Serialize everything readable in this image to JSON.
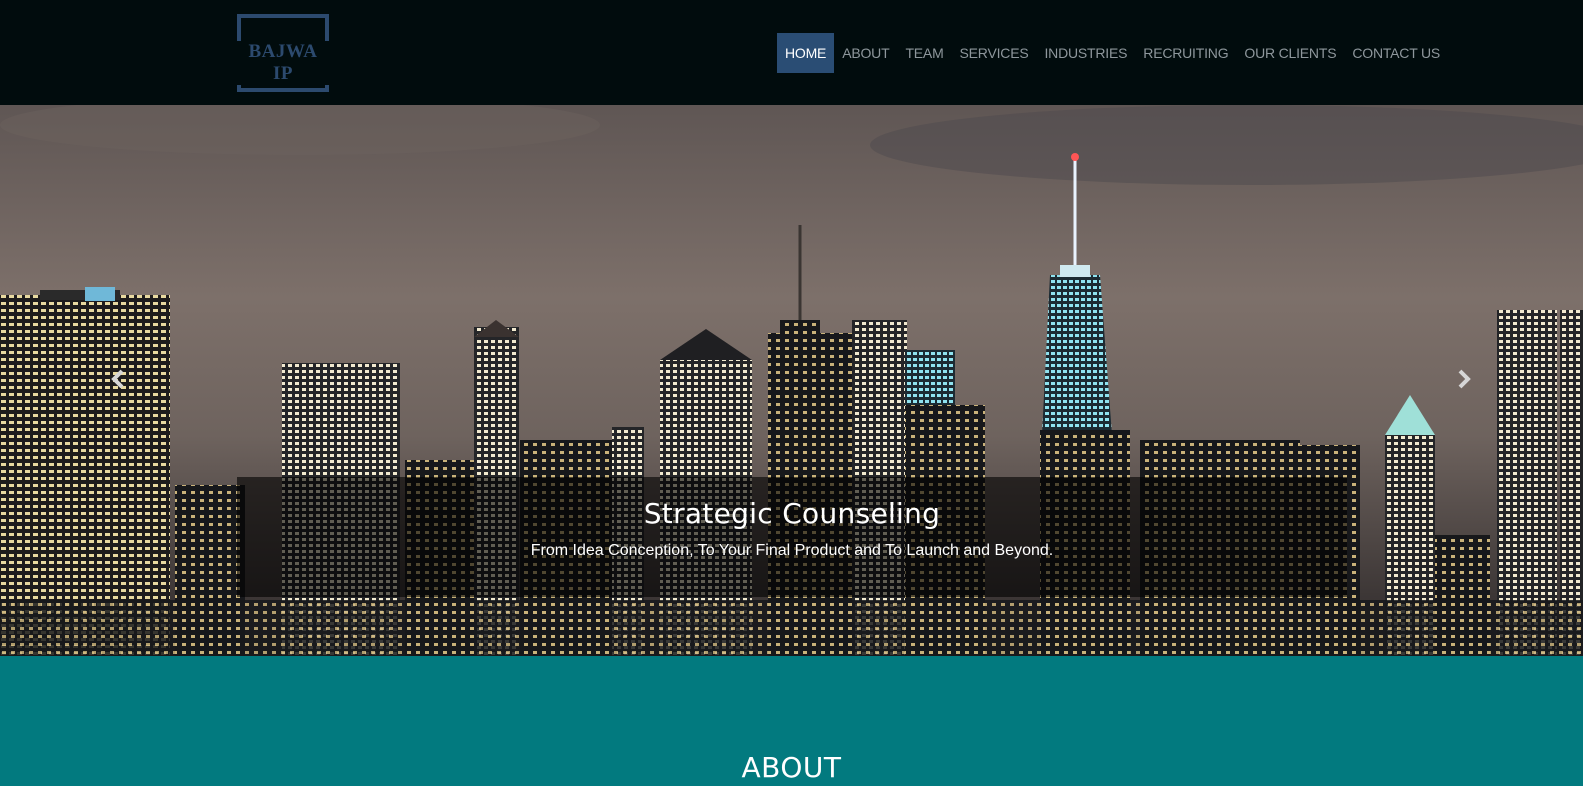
{
  "logo": {
    "text": "BAJWA IP"
  },
  "nav": {
    "items": [
      {
        "label": "HOME",
        "active": true
      },
      {
        "label": "ABOUT",
        "active": false
      },
      {
        "label": "TEAM",
        "active": false
      },
      {
        "label": "SERVICES",
        "active": false
      },
      {
        "label": "INDUSTRIES",
        "active": false
      },
      {
        "label": "RECRUITING",
        "active": false
      },
      {
        "label": "OUR CLIENTS",
        "active": false
      },
      {
        "label": "CONTACT US",
        "active": false
      }
    ]
  },
  "carousel": {
    "prev_icon": "chevron-left-icon",
    "next_icon": "chevron-right-icon",
    "caption_title": "Strategic Counseling",
    "caption_text": "From Idea Conception, To Your Final Product and To Launch and Beyond."
  },
  "about": {
    "heading": "ABOUT"
  },
  "colors": {
    "navbar_bg": "#010c0d",
    "nav_active_bg": "#2a4d74",
    "nav_text": "#8e979c",
    "about_bg": "#027a7f",
    "logo_color": "#2c4a6e"
  }
}
